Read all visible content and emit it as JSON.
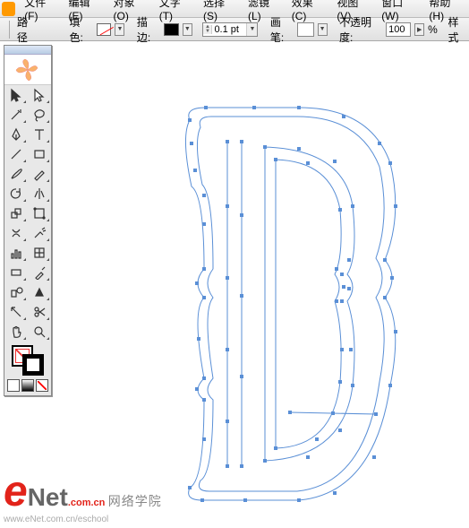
{
  "menu": {
    "file": "文件(F)",
    "edit": "编辑(E)",
    "object": "对象(O)",
    "type": "文字(T)",
    "select": "选择(S)",
    "filter": "滤镜(L)",
    "effect": "效果(C)",
    "view": "视图(V)",
    "window": "窗口(W)",
    "help": "帮助(H)"
  },
  "options": {
    "pathLabel": "路径",
    "fillLabel": "填色:",
    "strokeLabel": "描边:",
    "ptValue": "0.1 pt",
    "brushLabel": "画笔:",
    "opacityLabel": "不透明度:",
    "opacityValue": "100",
    "pct": "%",
    "styleLabel": "样式"
  },
  "watermark": {
    "e": "e",
    "net": "Net",
    "cn": "网络学院",
    "dotcom": ".com.cn",
    "url": "www.eNet.com.cn/eschool"
  },
  "tools": [
    [
      "selection-tool",
      "direct-select-tool"
    ],
    [
      "magic-wand-tool",
      "lasso-tool"
    ],
    [
      "pen-tool",
      "type-tool"
    ],
    [
      "line-tool",
      "rectangle-tool"
    ],
    [
      "brush-tool",
      "pencil-tool"
    ],
    [
      "rotate-tool",
      "reflect-tool"
    ],
    [
      "scale-tool",
      "free-transform-tool"
    ],
    [
      "warp-tool",
      "symbol-sprayer-tool"
    ],
    [
      "graph-tool",
      "mesh-tool"
    ],
    [
      "gradient-tool",
      "eyedropper-tool"
    ],
    [
      "blend-tool",
      "live-paint-tool"
    ],
    [
      "slice-tool",
      "scissors-tool"
    ],
    [
      "hand-tool",
      "zoom-tool"
    ]
  ]
}
